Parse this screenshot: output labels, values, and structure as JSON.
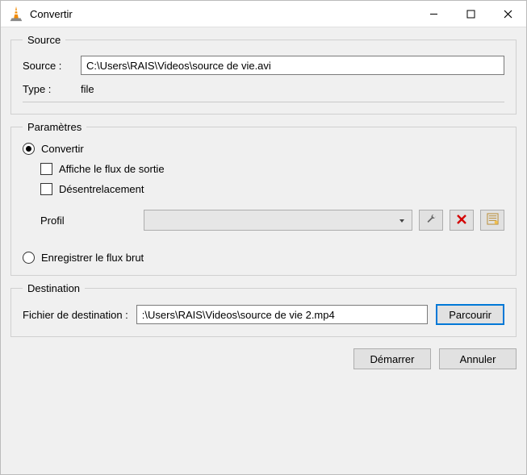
{
  "window": {
    "title": "Convertir"
  },
  "source": {
    "legend": "Source",
    "source_label": "Source :",
    "source_value": "C:\\Users\\RAIS\\Videos\\source de vie.avi",
    "type_label": "Type :",
    "type_value": "file"
  },
  "params": {
    "legend": "Paramètres",
    "convert_label": "Convertir",
    "show_output_label": "Affiche le flux de sortie",
    "deinterlace_label": "Désentrelacement",
    "profile_label": "Profil",
    "profile_value": "",
    "save_raw_label": "Enregistrer le flux brut"
  },
  "destination": {
    "legend": "Destination",
    "file_label": "Fichier de destination :",
    "file_value": ":\\Users\\RAIS\\Videos\\source de vie 2.mp4",
    "browse_label": "Parcourir"
  },
  "footer": {
    "start_label": "Démarrer",
    "cancel_label": "Annuler"
  }
}
